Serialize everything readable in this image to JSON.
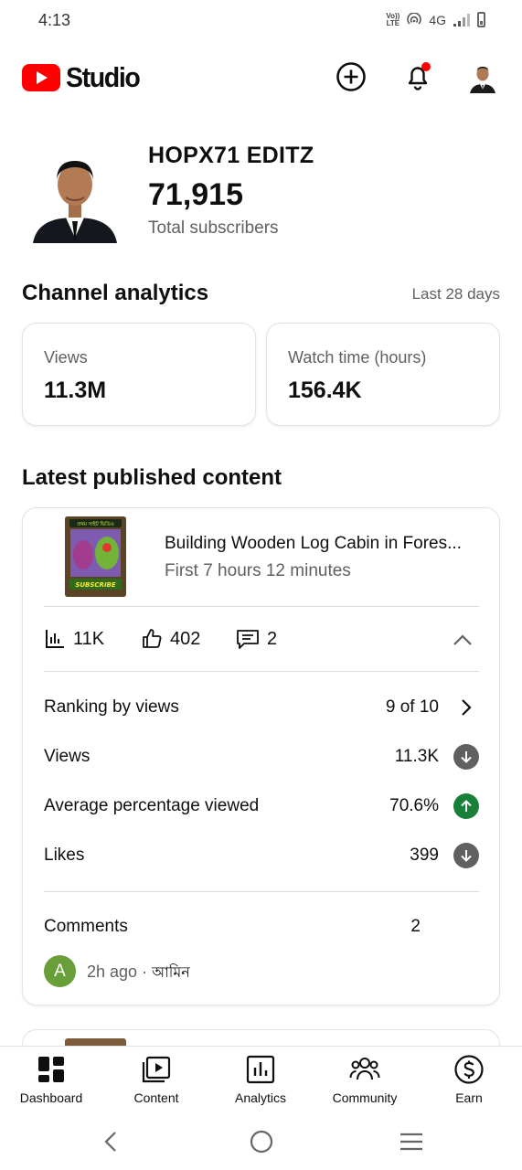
{
  "status_bar": {
    "time": "4:13",
    "volte_top": "Vo))",
    "volte_bottom": "LTE",
    "network": "4G"
  },
  "app_bar": {
    "logo_text": "Studio",
    "icons": [
      "youtube-logo-icon",
      "add-circle-icon",
      "notification-bell-icon",
      "account-avatar"
    ],
    "accent_red": "#ff0000"
  },
  "channel": {
    "name": "HOPX71 EDITZ",
    "subscribers": "71,915",
    "subscribers_label": "Total subscribers"
  },
  "analytics": {
    "title": "Channel analytics",
    "period": "Last 28 days",
    "metrics": [
      {
        "label": "Views",
        "value": "11.3M"
      },
      {
        "label": "Watch time (hours)",
        "value": "156.4K"
      }
    ]
  },
  "latest": {
    "title": "Latest published content",
    "video": {
      "thumbnail_top_text": "প্রথম সাইট ভিডিও",
      "thumbnail_bottom_text": "SUBSCRIBE",
      "title": "Building Wooden Log Cabin in Fores...",
      "subtitle": "First 7 hours 12 minutes",
      "stats": {
        "views": "11K",
        "likes": "402",
        "comments": "2"
      },
      "rows": [
        {
          "label": "Ranking by views",
          "value": "9 of 10",
          "indicator": "chevron-right"
        },
        {
          "label": "Views",
          "value": "11.3K",
          "indicator": "arrow-down",
          "color": "#606060"
        },
        {
          "label": "Average percentage viewed",
          "value": "70.6%",
          "indicator": "arrow-up",
          "color": "#188038"
        },
        {
          "label": "Likes",
          "value": "399",
          "indicator": "arrow-down",
          "color": "#606060"
        }
      ],
      "comments": {
        "label": "Comments",
        "count": "2",
        "latest": {
          "avatar_letter": "A",
          "avatar_color": "#689f38",
          "time": "2h ago",
          "separator": "·",
          "text": "আমিন"
        }
      }
    }
  },
  "bottom_nav": [
    {
      "label": "Dashboard",
      "icon": "dashboard-icon"
    },
    {
      "label": "Content",
      "icon": "content-icon"
    },
    {
      "label": "Analytics",
      "icon": "analytics-icon"
    },
    {
      "label": "Community",
      "icon": "community-icon"
    },
    {
      "label": "Earn",
      "icon": "earn-icon"
    }
  ],
  "system_nav": [
    "back-icon",
    "home-icon",
    "recents-icon"
  ]
}
